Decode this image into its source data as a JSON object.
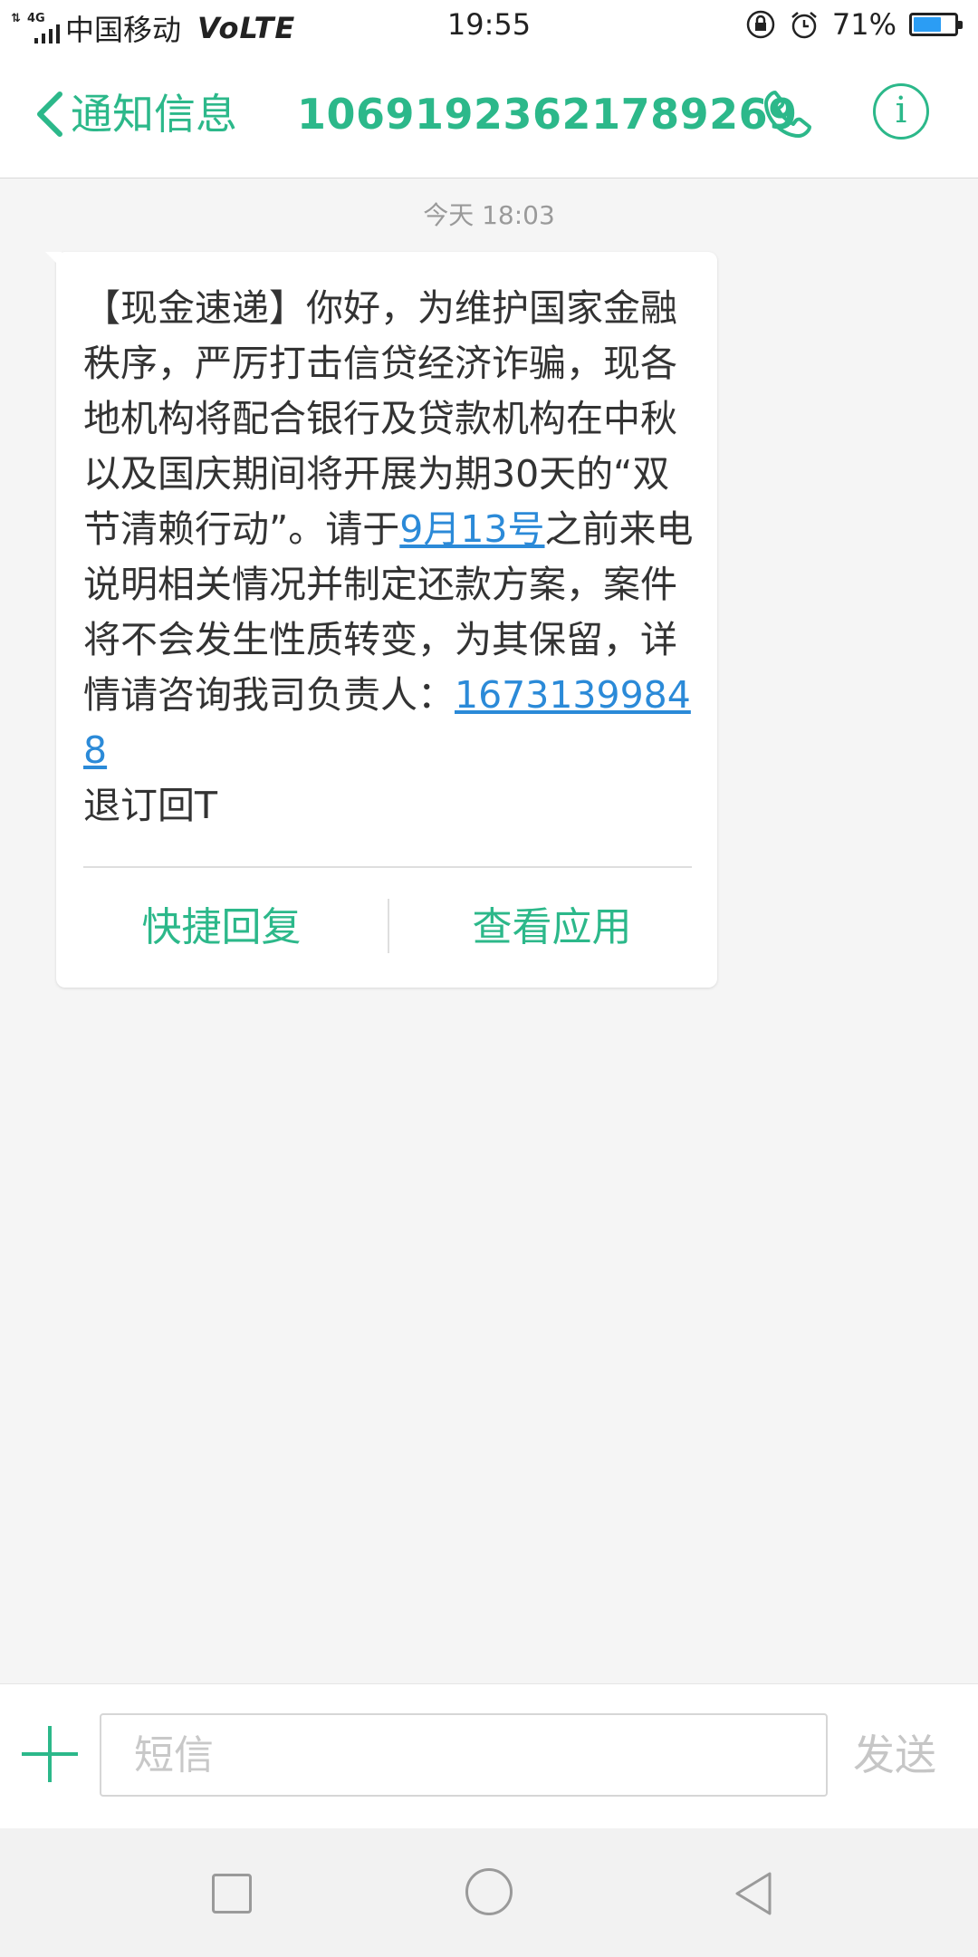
{
  "status_bar": {
    "network": "4G",
    "carrier": "中国移动",
    "volte": "VoLTE",
    "time": "19:55",
    "battery_percent": "71%",
    "battery_level": 0.71,
    "icons": [
      "signal-icon",
      "lock-rotation-icon",
      "alarm-icon",
      "battery-icon"
    ]
  },
  "header": {
    "back_label": "通知信息",
    "title": "10691923621789269",
    "icons": [
      "back-chevron-icon",
      "phone-icon",
      "info-icon"
    ]
  },
  "conversation": {
    "date_separator": "今天 18:03",
    "message": {
      "text_1": "【现金速递】你好，为维护国家金融秩序，严厉打击信贷经济诈骗，现各地机构将配合银行及贷款机构在中秋以及国庆期间将开展为期30天的“双节清赖行动”。请于",
      "link_date": "9月13号",
      "text_2": "之前来电说明相关情况并制定还款方案，案件将不会发生性质转变，为其保留，详情请咨询我司负责人：",
      "link_phone": "16731399848",
      "text_3": "退订回T"
    },
    "actions": {
      "quick_reply": "快捷回复",
      "view_app": "查看应用"
    }
  },
  "composer": {
    "placeholder": "短信",
    "send_label": "发送"
  },
  "colors": {
    "accent": "#2cb88a",
    "link": "#2b8ad8",
    "background": "#f5f5f5",
    "battery": "#2b9df4"
  }
}
